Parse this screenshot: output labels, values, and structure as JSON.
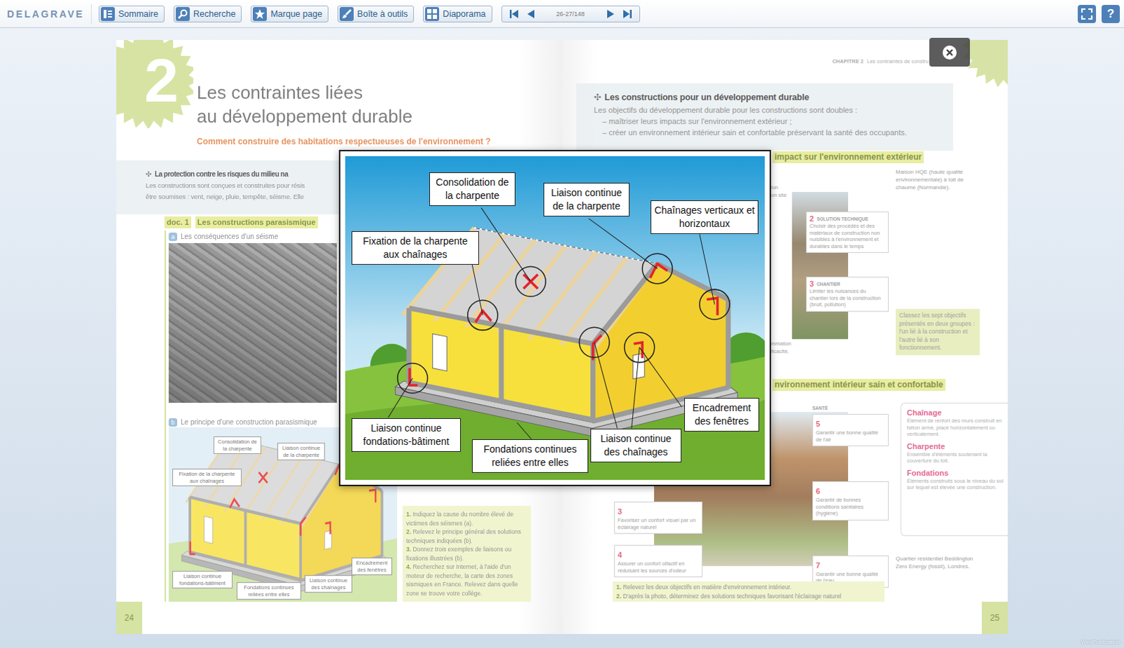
{
  "toolbar": {
    "logo": "DELAGRAVE",
    "buttons": [
      {
        "label": "Sommaire"
      },
      {
        "label": "Recherche"
      },
      {
        "label": "Marque page"
      },
      {
        "label": "Boîte à outils"
      },
      {
        "label": "Diaporama"
      }
    ],
    "page_indicator": "26-27/148",
    "help": "?"
  },
  "left_page": {
    "chapter_number": "2",
    "title": [
      "Les contraintes liées",
      "au développement durable"
    ],
    "question": "Comment construire des habitations respectueuses de l'environnement ?",
    "section": {
      "marker": "✣",
      "heading": "La protection contre les risques du milieu na",
      "text": [
        "Les constructions sont conçues et construites pour résis",
        "être soumises : vent, neige, pluie, tempête, séisme. Elle"
      ]
    },
    "doc": {
      "label": "doc. 1",
      "title": "Les constructions parasismique"
    },
    "part_a": {
      "letter": "a",
      "caption": "Les conséquences d'un séisme"
    },
    "part_b": {
      "letter": "b",
      "caption": "Le principe d'une construction parasismique",
      "labels": [
        "Consolidation de la charpente",
        "Liaison continue de la charpente",
        "Fixation de la charpente aux chaînages",
        "Liaison continue fondations-bâtiment",
        "Fondations continues reliées entre elles",
        "Liaison continue des chaînages",
        "Encadrement des fenêtres"
      ]
    },
    "questions": [
      {
        "number": "1.",
        "text": "Indiquez la cause du nombre élevé de victimes des séismes (a)."
      },
      {
        "number": "2.",
        "text": "Relevez le principe général des solutions techniques indiquées (b)."
      },
      {
        "number": "3.",
        "text": "Donnez trois exemples de liaisons ou fixations illustrées (b)."
      },
      {
        "number": "4.",
        "text": "Recherchez sur Internet, à l'aide d'un moteur de recherche, la carte des zones sismiques en France. Relevez dans quelle zone se trouve votre collège."
      }
    ],
    "page_number": "24"
  },
  "right_page": {
    "running_head": {
      "chapter": "CHAPITRE 2",
      "title": "Les contraintes de constru"
    },
    "section": {
      "marker": "✣",
      "heading": "Les constructions pour un développement durable",
      "intro": "Les objectifs du développement durable pour les constructions sont doubles :",
      "items": [
        "– maîtriser leurs impacts sur l'environnement extérieur ;",
        "– créer un environnement intérieur sain et confortable préservant la santé des occupants."
      ]
    },
    "doc2_heading": "impact sur l'environnement extérieur",
    "fragments": [
      "ion",
      "on site",
      "mmation",
      "ficacité,"
    ],
    "hqe_caption": "Maison HQE (haute qualité environnementale) à toit de chaume (Normandie).",
    "objectives_top": [
      {
        "number": "2",
        "category": "SOLUTION TECHNIQUE",
        "text": "Choisir des procédés et des matériaux de construction non nuisibles à l'environnement et durables dans le temps"
      },
      {
        "number": "3",
        "category": "CHANTIER",
        "text": "Limiter les nuisances du chantier lors de la construction (bruit, pollution)"
      }
    ],
    "note": "Classez les sept objectifs présentés en deux groupes : l'un lié à la construction et l'autre lié à son fonctionnement.",
    "doc3_heading": "nvironnement intérieur sain et confortable",
    "sante_label": "SANTÉ",
    "objectives_left": [
      {
        "number": "3",
        "text": "Favoriser un confort visuel par un éclairage naturel"
      },
      {
        "number": "4",
        "text": "Assurer un confort olfactif en réduisant les sources d'odeur"
      }
    ],
    "objectives_right": [
      {
        "number": "5",
        "text": "Garantir une bonne qualité de l'air"
      },
      {
        "number": "6",
        "text": "Garantir de bonnes conditions sanitaires (hygiène)"
      },
      {
        "number": "7",
        "text": "Garantir une bonne qualité de l'eau"
      }
    ],
    "glossary": [
      {
        "term": "Chaînage",
        "definition": "Élément de renfort des murs construit en béton armé, placé horizontalement ou verticalement."
      },
      {
        "term": "Charpente",
        "definition": "Ensemble d'éléments soutenant la couverture du toit."
      },
      {
        "term": "Fondations",
        "definition": "Éléments construits sous le niveau du sol sur lequel est élevée une construction."
      }
    ],
    "beddington_caption": "Quartier résidentiel Beddington Zero Energy (fossil), Londres.",
    "questions": [
      {
        "number": "1.",
        "text": "Relevez les deux objectifs en matière d'environnement intérieur."
      },
      {
        "number": "2.",
        "text": "D'après la photo, déterminez des solutions techniques favorisant l'éclairage naturel"
      }
    ],
    "page_number": "25"
  },
  "popup": {
    "labels": [
      "Consolidation de la charpente",
      "Liaison continue de la charpente",
      "Chaînages verticaux et horizontaux",
      "Fixation de la charpente aux chaînages",
      "Liaison continue fondations-bâtiment",
      "Fondations continues reliées entre elles",
      "Liaison continue des chaînages",
      "Encadrement des fenêtres"
    ]
  },
  "footer": "WebPublication"
}
